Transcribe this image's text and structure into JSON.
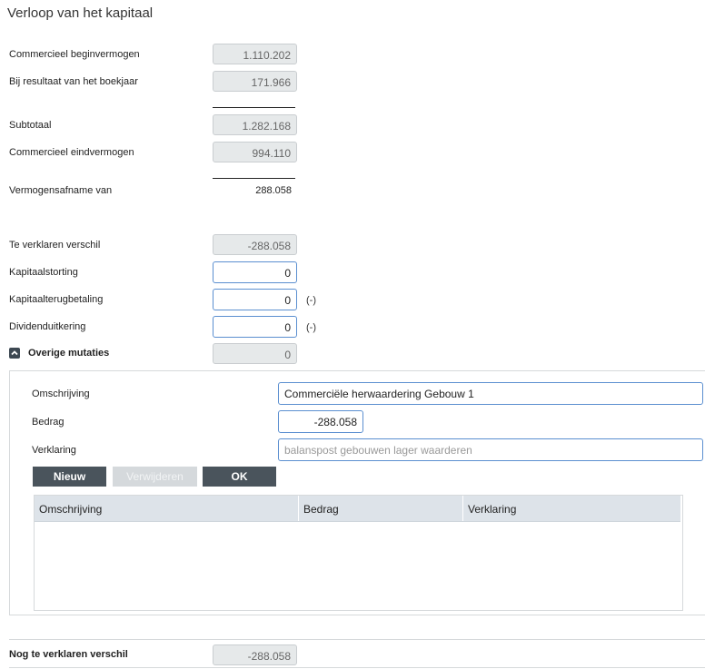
{
  "title": "Verloop van het kapitaal",
  "rows": {
    "commercieel_begin": {
      "label": "Commercieel beginvermogen",
      "value": "1.110.202"
    },
    "bij_resultaat": {
      "label": "Bij resultaat van het boekjaar",
      "value": "171.966"
    },
    "subtotaal": {
      "label": "Subtotaal",
      "value": "1.282.168"
    },
    "commercieel_eind": {
      "label": "Commercieel eindvermogen",
      "value": "994.110"
    },
    "vermogensafname": {
      "label": "Vermogensafname van",
      "value": "288.058"
    },
    "te_verklaren": {
      "label": "Te verklaren verschil",
      "value": "-288.058"
    },
    "kapitaalstorting": {
      "label": "Kapitaalstorting",
      "value": "0"
    },
    "kapitaalterugbetaling": {
      "label": "Kapitaalterugbetaling",
      "value": "0",
      "hint": "(-)"
    },
    "dividenduitkering": {
      "label": "Dividenduitkering",
      "value": "0",
      "hint": "(-)"
    },
    "overige_mutaties": {
      "label": "Overige mutaties",
      "value": "0"
    }
  },
  "mutatie": {
    "omschrijving_label": "Omschrijving",
    "omschrijving_value": "Commerciële herwaardering Gebouw 1",
    "bedrag_label": "Bedrag",
    "bedrag_value": "-288.058",
    "verklaring_label": "Verklaring",
    "verklaring_placeholder": "balanspost gebouwen lager waarderen",
    "buttons": {
      "nieuw": "Nieuw",
      "verwijderen": "Verwijderen",
      "ok": "OK"
    },
    "table_headers": [
      "Omschrijving",
      "Bedrag",
      "Verklaring"
    ]
  },
  "nog_te_verklaren": {
    "label": "Nog te verklaren verschil",
    "value": "-288.058"
  },
  "colors": {
    "accent_border": "#5b8fd0",
    "button_dark": "#4a545c",
    "readonly_bg": "#e6e9ea"
  }
}
